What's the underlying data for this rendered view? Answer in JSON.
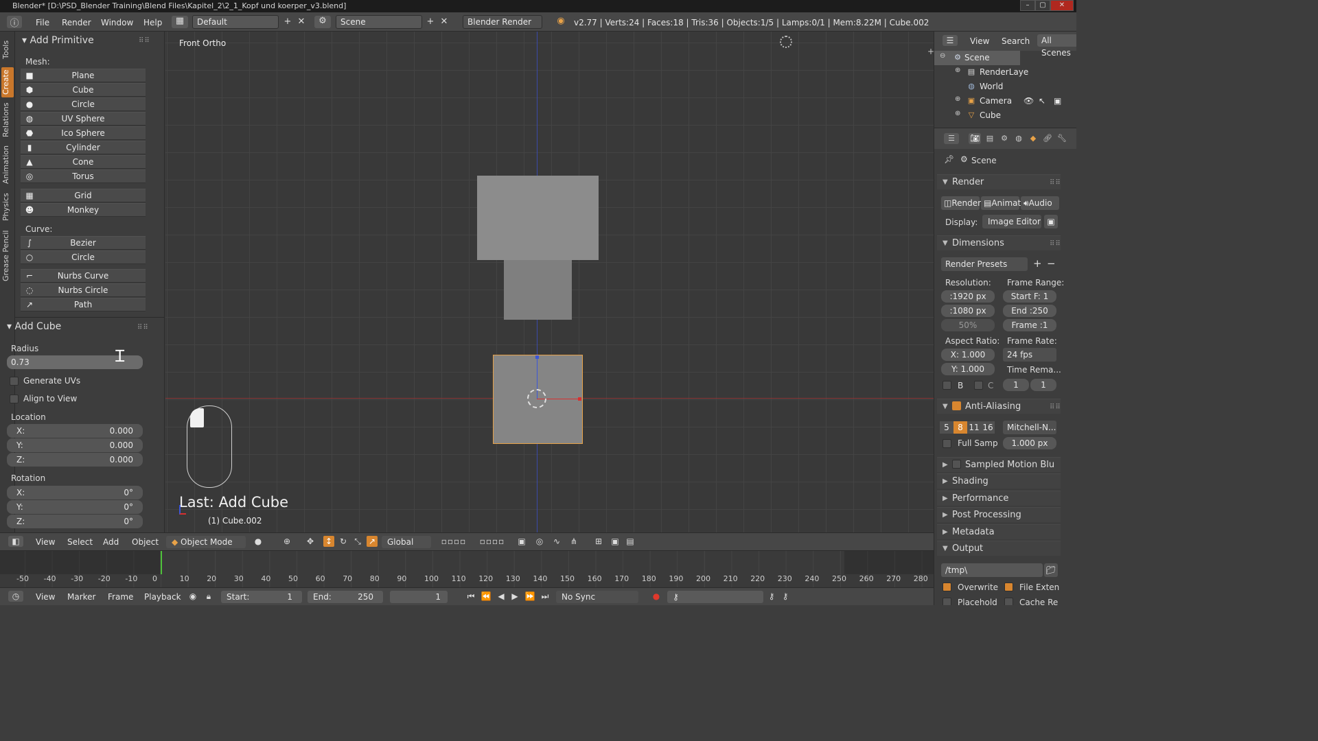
{
  "window": {
    "title": "Blender* [D:\\PSD_Blender Training\\Blend Files\\Kapitel_2\\2_1_Kopf und koerper_v3.blend]"
  },
  "info_header": {
    "menus": [
      "File",
      "Render",
      "Window",
      "Help"
    ],
    "layout": "Default",
    "scene": "Scene",
    "engine": "Blender Render",
    "stats": "v2.77 | Verts:24 | Faces:18 | Tris:36 | Objects:1/5 | Lamps:0/1 | Mem:8.22M | Cube.002"
  },
  "tool_tabs": [
    "Tools",
    "Create",
    "Relations",
    "Animation",
    "Physics",
    "Grease Pencil"
  ],
  "add_primitive": {
    "title": "Add Primitive",
    "mesh_label": "Mesh:",
    "mesh_items": [
      "Plane",
      "Cube",
      "Circle",
      "UV Sphere",
      "Ico Sphere",
      "Cylinder",
      "Cone",
      "Torus",
      "Grid",
      "Monkey"
    ],
    "curve_label": "Curve:",
    "curve_items": [
      "Bezier",
      "Circle",
      "Nurbs Curve",
      "Nurbs Circle",
      "Path"
    ]
  },
  "add_cube": {
    "title": "Add Cube",
    "radius_label": "Radius",
    "radius_value": "0.73",
    "generate_uvs": "Generate UVs",
    "align_to_view": "Align to View",
    "location_label": "Location",
    "location": {
      "x_label": "X:",
      "x": "0.000",
      "y_label": "Y:",
      "y": "0.000",
      "z_label": "Z:",
      "z": "0.000"
    },
    "rotation_label": "Rotation",
    "rotation": {
      "x_label": "X:",
      "x": "0°",
      "y_label": "Y:",
      "y": "0°",
      "z_label": "Z:",
      "z": "0°"
    }
  },
  "viewport": {
    "view_label": "Front Ortho",
    "last_op": "Last: Add Cube",
    "object_name": "(1) Cube.002"
  },
  "view3d_header": {
    "menus": [
      "View",
      "Select",
      "Add",
      "Object"
    ],
    "mode": "Object Mode",
    "orientation": "Global"
  },
  "timeline": {
    "ticks": [
      "-50",
      "-40",
      "-30",
      "-20",
      "-10",
      "0",
      "10",
      "20",
      "30",
      "40",
      "50",
      "60",
      "70",
      "80",
      "90",
      "100",
      "110",
      "120",
      "130",
      "140",
      "150",
      "160",
      "170",
      "180",
      "190",
      "200",
      "210",
      "220",
      "230",
      "240",
      "250",
      "260",
      "270",
      "280"
    ],
    "menus": [
      "View",
      "Marker",
      "Frame",
      "Playback"
    ],
    "start_label": "Start:",
    "start": "1",
    "end_label": "End:",
    "end": "250",
    "current": "1",
    "sync": "No Sync"
  },
  "outliner": {
    "menus": [
      "View",
      "Search",
      "All Scenes"
    ],
    "items": [
      "Scene",
      "RenderLaye",
      "World",
      "Camera",
      "Cube"
    ]
  },
  "properties": {
    "context": "Scene",
    "render_panel": "Render",
    "render_buttons": [
      "Render",
      "Animat",
      "Audio"
    ],
    "display_label": "Display:",
    "display_value": "Image Editor",
    "dimensions_panel": "Dimensions",
    "render_presets": "Render Presets",
    "resolution_label": "Resolution:",
    "res_x": ":1920 px",
    "res_y": ":1080 px",
    "res_pct": "50%",
    "frame_range_label": "Frame Range:",
    "start_f": "Start F: 1",
    "end_f": "End :250",
    "frame": "Frame :1",
    "aspect_label": "Aspect Ratio:",
    "aspect_x": "X:  1.000",
    "aspect_y": "Y:  1.000",
    "frame_rate_label": "Frame Rate:",
    "fps": "24 fps",
    "time_rema": "Time Rema...",
    "b_label": "B",
    "c_label": "C",
    "old": "1",
    "new": "1",
    "aa_panel": "Anti-Aliasing",
    "aa_samples": [
      "5",
      "8",
      "11",
      "16"
    ],
    "aa_filter": "Mitchell-N...",
    "full_samp": "Full Samp",
    "filter_size": "1.000 px",
    "collapsed_panels": [
      "Sampled Motion Blu",
      "Shading",
      "Performance",
      "Post Processing",
      "Metadata"
    ],
    "output_panel": "Output",
    "output_path": "/tmp\\",
    "overwrite": "Overwrite",
    "file_exten": "File Exten",
    "placehold": "Placehold",
    "cache_re": "Cache Re"
  }
}
